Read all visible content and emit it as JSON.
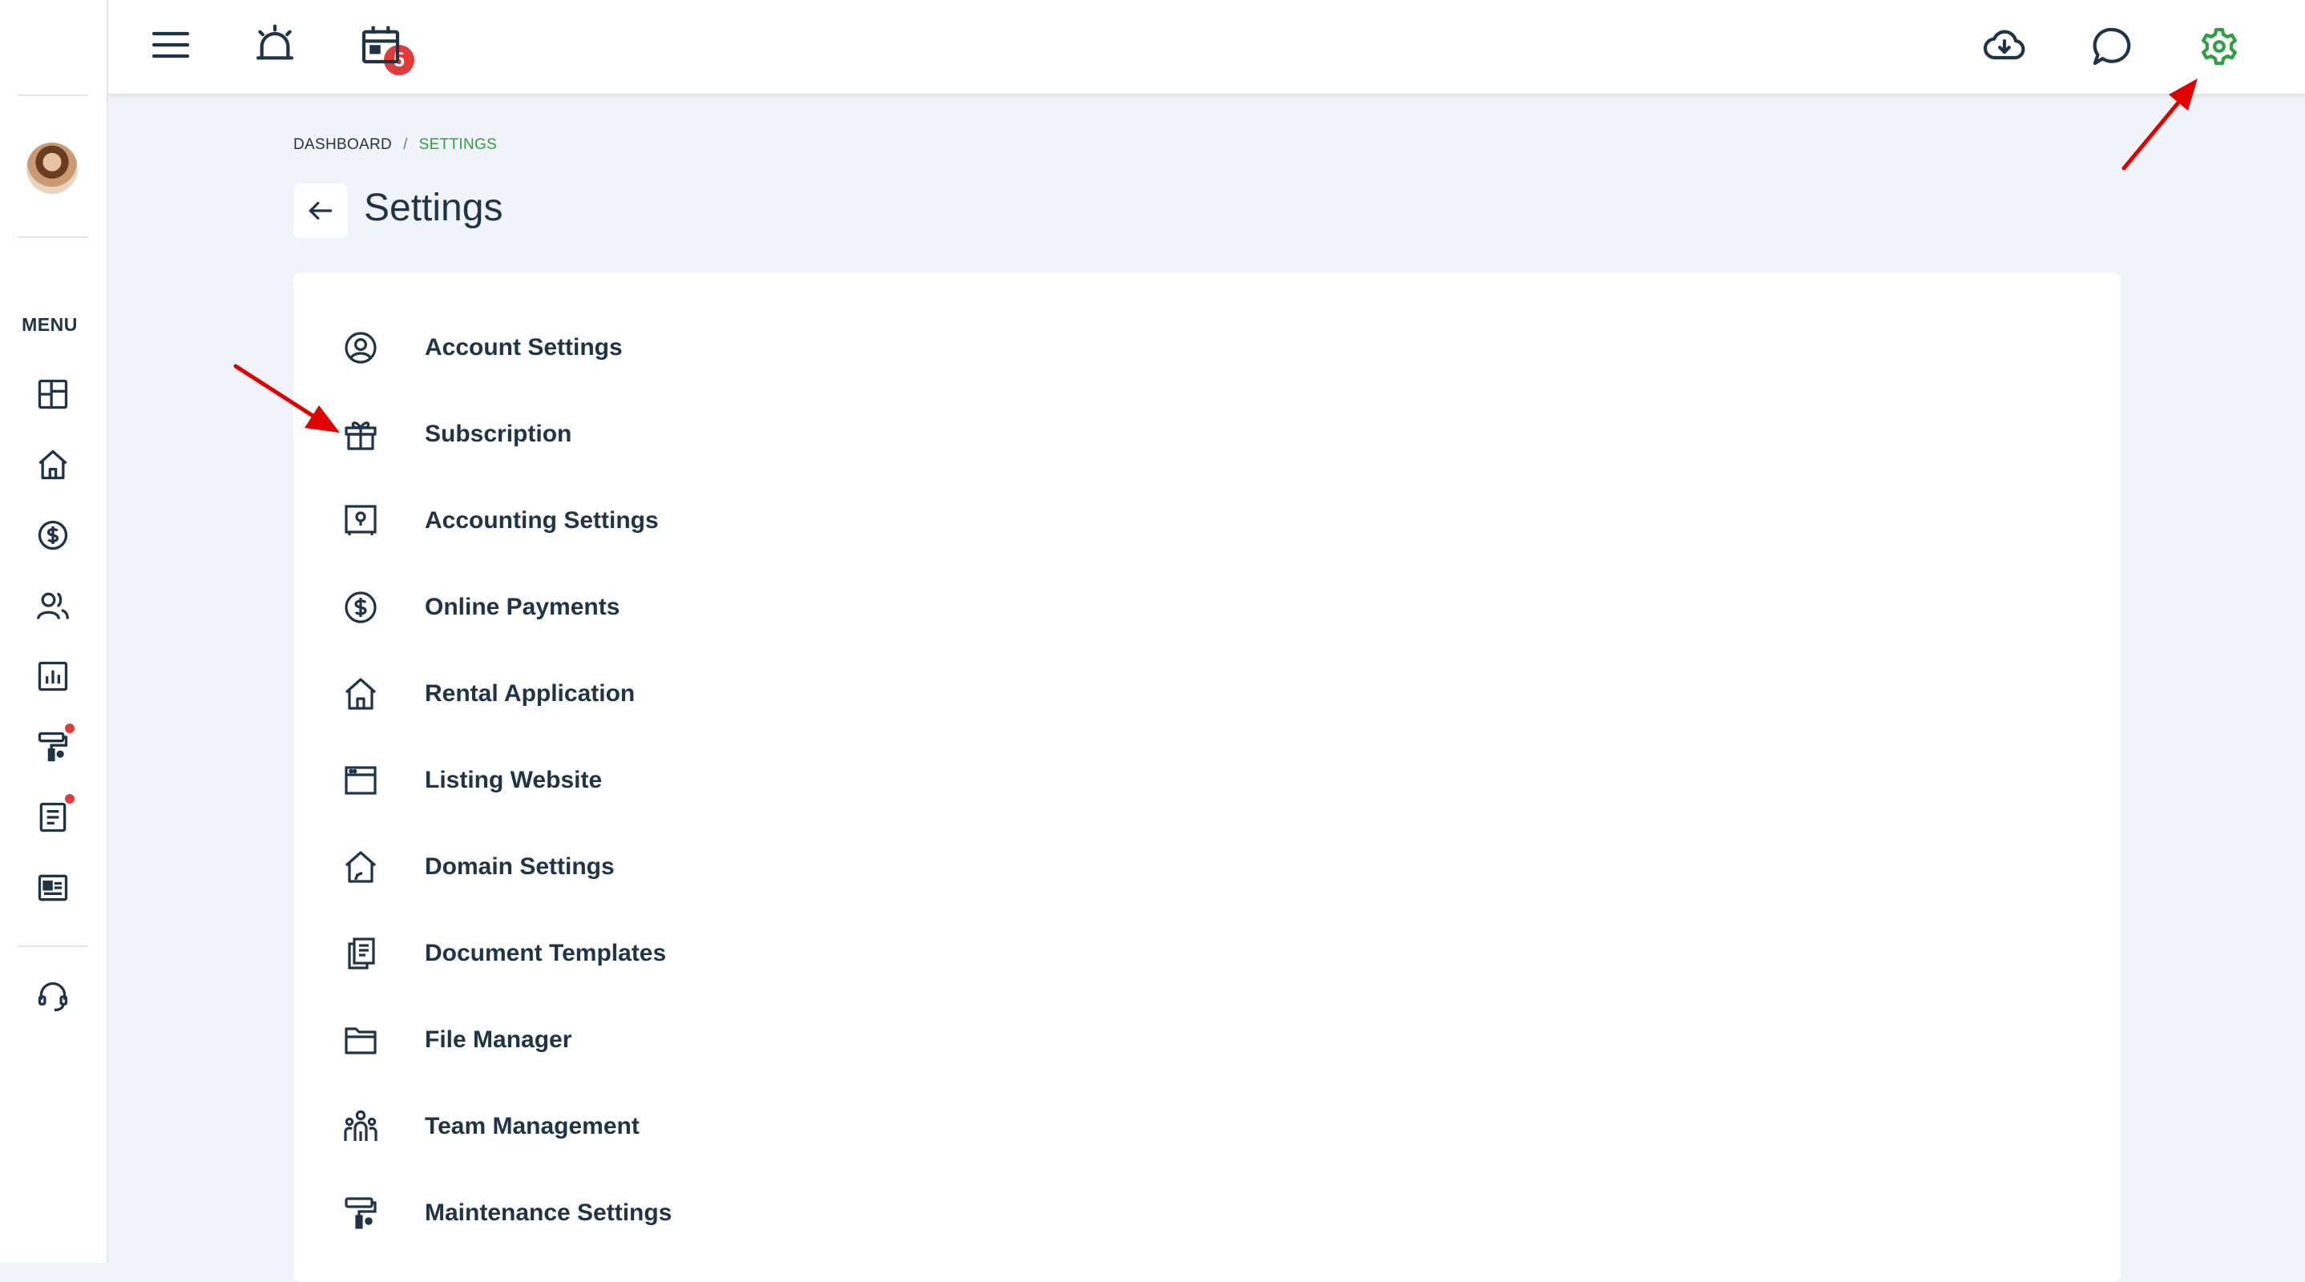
{
  "colors": {
    "accent_green": "#2f9e44",
    "badge_red": "#e23b3b",
    "text_dark": "#1f3447",
    "annotation_red": "#e00000",
    "page_bg": "#f0f3f7"
  },
  "sidebar": {
    "menu_label": "MENU",
    "icons": [
      "dashboard-icon",
      "home-icon",
      "dollar-circle-icon",
      "users-icon",
      "bar-chart-icon",
      "paint-roller-icon",
      "document-icon",
      "id-card-icon",
      "headset-icon"
    ]
  },
  "topbar": {
    "notification_count": "5",
    "icons": [
      "hamburger-menu-icon",
      "alarm-bell-icon",
      "calendar-icon",
      "cloud-download-icon",
      "chat-bubble-icon",
      "gear-icon"
    ]
  },
  "breadcrumb": {
    "home": "DASHBOARD",
    "separator": "/",
    "current": "SETTINGS"
  },
  "page": {
    "title": "Settings"
  },
  "settings_items": [
    {
      "label": "Account Settings",
      "icon": "user-circle-icon"
    },
    {
      "label": "Subscription",
      "icon": "gift-icon"
    },
    {
      "label": "Accounting Settings",
      "icon": "safe-icon"
    },
    {
      "label": "Online Payments",
      "icon": "dollar-circle-icon"
    },
    {
      "label": "Rental Application",
      "icon": "home-icon"
    },
    {
      "label": "Listing Website",
      "icon": "browser-window-icon"
    },
    {
      "label": "Domain Settings",
      "icon": "house-link-icon"
    },
    {
      "label": "Document Templates",
      "icon": "documents-icon"
    },
    {
      "label": "File Manager",
      "icon": "folder-icon"
    },
    {
      "label": "Team Management",
      "icon": "team-icon"
    },
    {
      "label": "Maintenance Settings",
      "icon": "paint-roller-icon"
    }
  ]
}
